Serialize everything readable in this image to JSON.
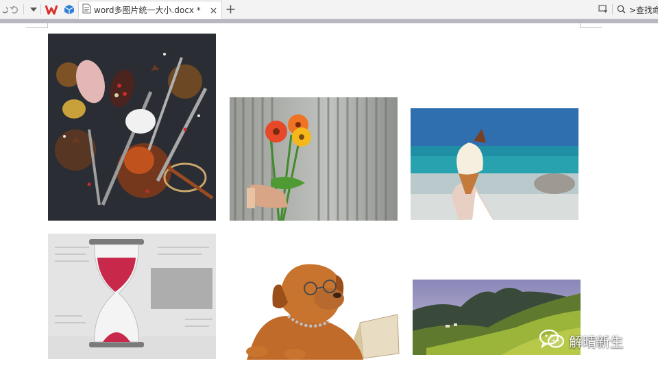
{
  "document_tab": {
    "title": "word多图片统一大小.docx *"
  },
  "search": {
    "label": ">查找命"
  },
  "watermark": {
    "text": "解晴新生"
  },
  "images": [
    {
      "subject": "spices in spoons"
    },
    {
      "subject": "hand holding flowers by fence"
    },
    {
      "subject": "hand holding ice cream cone by sea"
    },
    {
      "subject": "hourglass on newspaper"
    },
    {
      "subject": "dog with glasses and book"
    },
    {
      "subject": "green hills landscape"
    }
  ],
  "colors": {
    "wps_red": "#d9312b",
    "accent_blue": "#2f7fd3",
    "tab_bar": "#f3f3f3",
    "strip": "#b7b7c1"
  }
}
